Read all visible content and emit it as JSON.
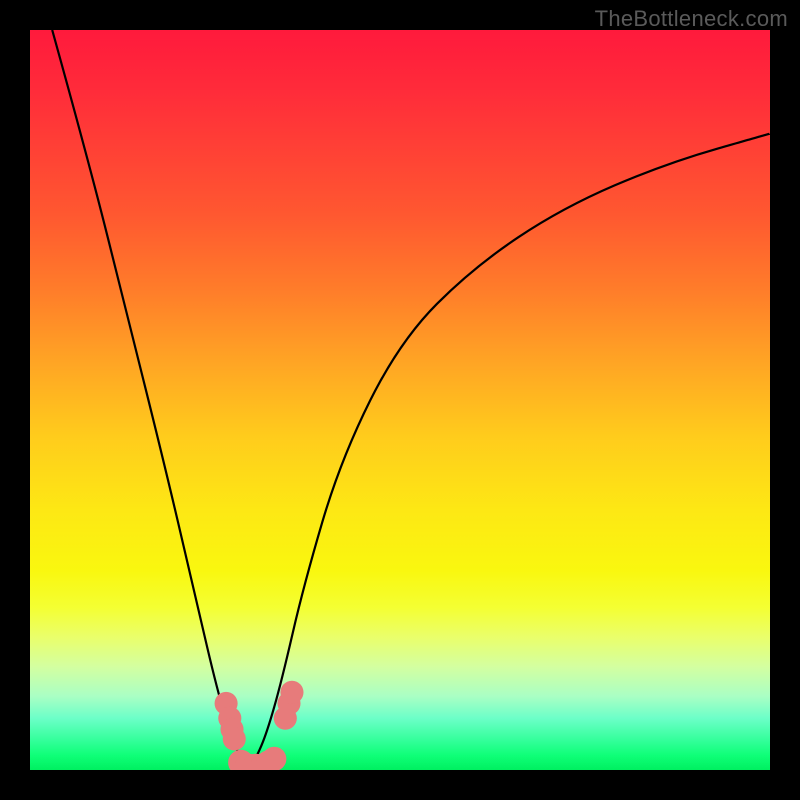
{
  "watermark": "TheBottleneck.com",
  "chart_data": {
    "type": "line",
    "title": "",
    "xlabel": "",
    "ylabel": "",
    "xlim": [
      0,
      100
    ],
    "ylim": [
      0,
      100
    ],
    "series": [
      {
        "name": "bottleneck-curve",
        "x": [
          3,
          8,
          13,
          18,
          22,
          25,
          27,
          28.5,
          29.5,
          30.5,
          32,
          34,
          37,
          42,
          50,
          60,
          72,
          86,
          100
        ],
        "y": [
          100,
          82,
          62,
          42,
          25,
          12,
          5,
          1.5,
          0.2,
          1.5,
          5,
          12,
          25,
          42,
          58,
          68,
          76,
          82,
          86
        ]
      }
    ],
    "markers": [
      {
        "x": 26.5,
        "y": 9,
        "r": 1.2
      },
      {
        "x": 27.0,
        "y": 7,
        "r": 1.2
      },
      {
        "x": 27.3,
        "y": 5.5,
        "r": 1.2
      },
      {
        "x": 27.6,
        "y": 4.2,
        "r": 1.2
      },
      {
        "x": 28.5,
        "y": 1.0,
        "r": 1.4
      },
      {
        "x": 29.5,
        "y": 0.3,
        "r": 1.6
      },
      {
        "x": 30.5,
        "y": 0.3,
        "r": 1.6
      },
      {
        "x": 31.5,
        "y": 0.5,
        "r": 1.4
      },
      {
        "x": 32.2,
        "y": 1.0,
        "r": 1.3
      },
      {
        "x": 33.0,
        "y": 1.5,
        "r": 1.3
      },
      {
        "x": 34.5,
        "y": 7.0,
        "r": 1.2
      },
      {
        "x": 35.0,
        "y": 9.0,
        "r": 1.2
      },
      {
        "x": 35.4,
        "y": 10.5,
        "r": 1.2
      }
    ],
    "gradient_stops": [
      {
        "pos": 0,
        "color": "#ff1a3c"
      },
      {
        "pos": 25,
        "color": "#ff5830"
      },
      {
        "pos": 55,
        "color": "#ffcc1c"
      },
      {
        "pos": 78,
        "color": "#f4ff32"
      },
      {
        "pos": 92,
        "color": "#8fffc8"
      },
      {
        "pos": 100,
        "color": "#00f060"
      }
    ]
  }
}
